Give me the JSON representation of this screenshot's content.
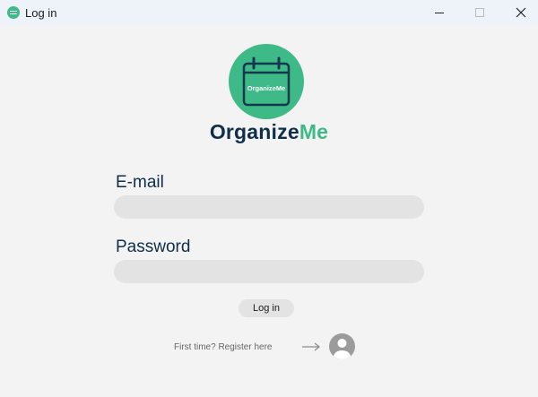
{
  "window": {
    "title": "Log in",
    "controls": {
      "minimize_icon": "minimize-icon",
      "maximize_icon": "maximize-icon",
      "close_icon": "close-icon"
    }
  },
  "logo": {
    "icon": "calendar-icon",
    "badge_text": "OrganizeMe",
    "brand_primary": "Organize",
    "brand_accent": "Me",
    "colors": {
      "accent": "#3dba87",
      "navy": "#0f2e4a"
    }
  },
  "form": {
    "email": {
      "label": "E-mail",
      "value": "",
      "placeholder": ""
    },
    "password": {
      "label": "Password",
      "value": "",
      "placeholder": ""
    },
    "login_button": "Log in"
  },
  "register": {
    "text": "First time? Register here",
    "arrow_icon": "arrow-right-icon",
    "avatar_icon": "user-avatar-icon"
  }
}
